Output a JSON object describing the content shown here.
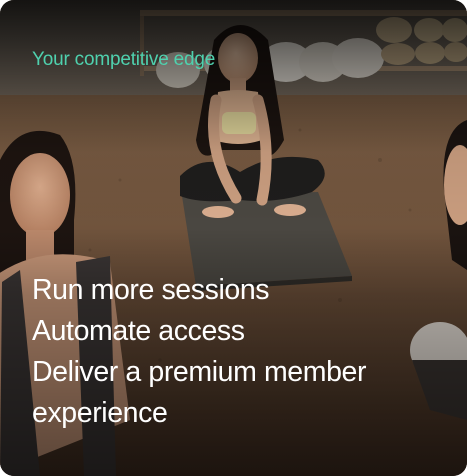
{
  "card": {
    "eyebrow": "Your competitive edge",
    "headlines": [
      "Run more sessions",
      "Automate access",
      "Deliver a premium member experience"
    ]
  },
  "colors": {
    "eyebrow": "#4fd1ae",
    "headline": "#ffffff"
  }
}
